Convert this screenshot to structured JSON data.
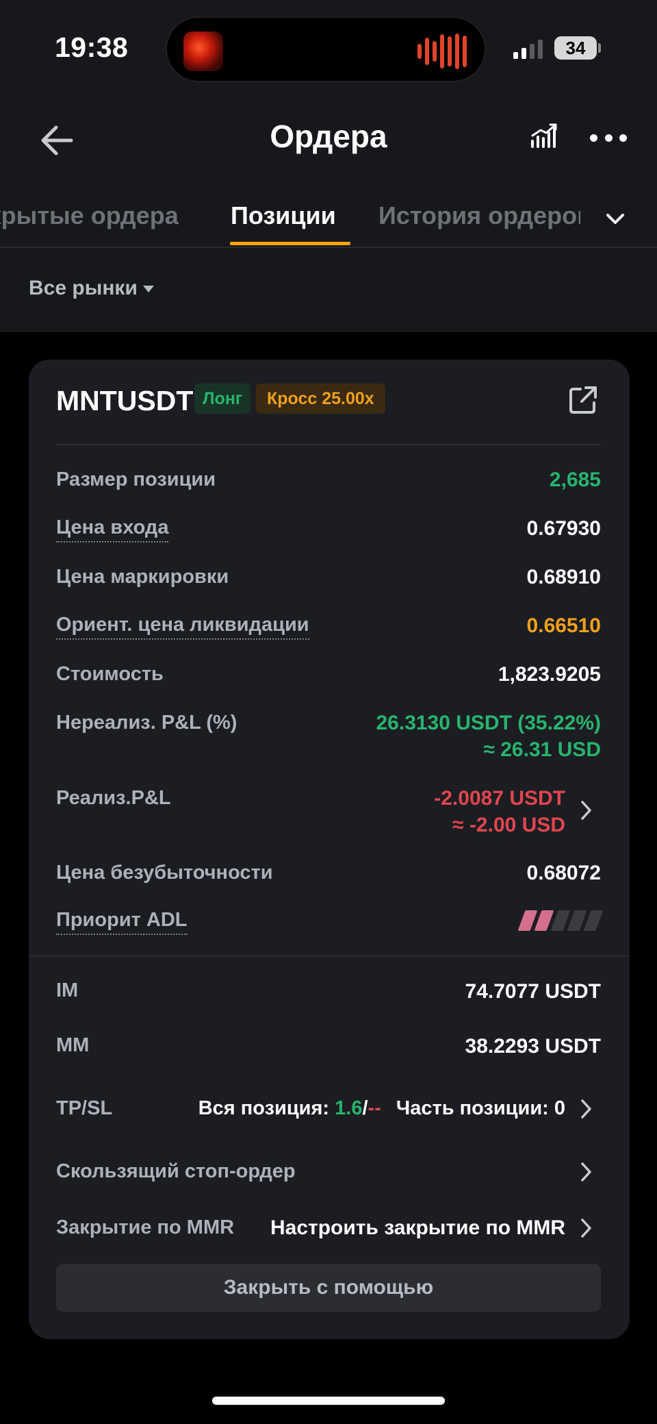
{
  "status_bar": {
    "time": "19:38",
    "battery": "34"
  },
  "header": {
    "title": "Ордера"
  },
  "tabs": [
    {
      "label": "Открытые ордера"
    },
    {
      "label": "Позиции",
      "active": true
    },
    {
      "label": "История ордеров"
    }
  ],
  "filter": {
    "label": "Все рынки"
  },
  "position": {
    "symbol": "MNTUSDT",
    "side_badge": "Лонг",
    "margin_badge": "Кросс 25.00x",
    "rows": {
      "size": {
        "label": "Размер позиции",
        "value": "2,685"
      },
      "entry": {
        "label": "Цена входа",
        "value": "0.67930"
      },
      "mark": {
        "label": "Цена маркировки",
        "value": "0.68910"
      },
      "liq": {
        "label": "Ориент. цена ликвидации",
        "value": "0.66510"
      },
      "value": {
        "label": "Стоимость",
        "value": "1,823.9205"
      },
      "upnl": {
        "label": "Нереализ. P&L (%)",
        "value": "26.3130 USDT (35.22%)",
        "value2": "≈ 26.31 USD"
      },
      "rpnl": {
        "label": "Реализ.P&L",
        "value": "-2.0087 USDT",
        "value2": "≈ -2.00 USD"
      },
      "breakeven": {
        "label": "Цена безубыточности",
        "value": "0.68072"
      },
      "adl": {
        "label": "Приорит ADL",
        "level": 2,
        "max": 5
      },
      "im": {
        "label": "IM",
        "value": "74.7077 USDT"
      },
      "mm": {
        "label": "MM",
        "value": "38.2293 USDT"
      },
      "tpsl": {
        "label": "TP/SL",
        "full_prefix": "Вся позиция: ",
        "full_tp": "1.6",
        "full_sep": "/",
        "full_sl": "--",
        "partial": "Часть позиции: 0"
      },
      "trailing": {
        "label": "Скользящий стоп-ордер"
      },
      "mmr": {
        "label": "Закрытие по MMR",
        "value": "Настроить закрытие по MMR"
      }
    },
    "close_button": "Закрыть с помощью"
  },
  "colors": {
    "accent": "#f7a600",
    "profit": "#27b56d",
    "loss": "#e0464e",
    "warning": "#f0a01c"
  }
}
